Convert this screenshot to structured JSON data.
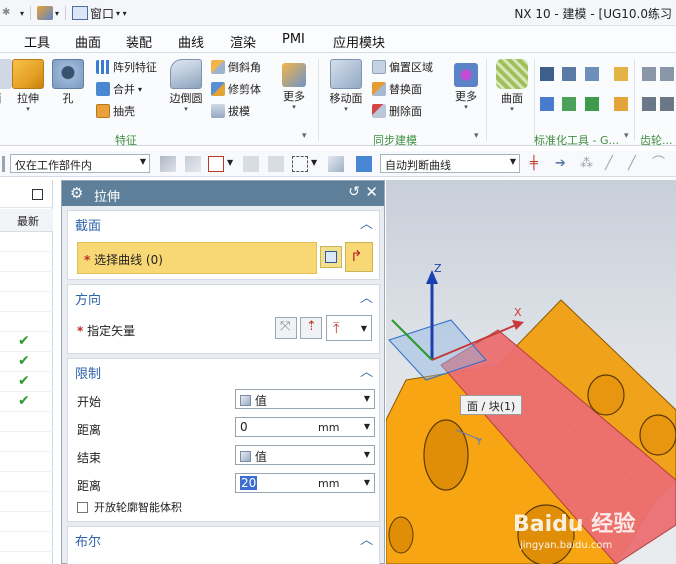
{
  "window": {
    "title": "NX 10 - 建模 - [UG10.0练习"
  },
  "quick_access": {
    "window_menu": "窗口"
  },
  "menubar": {
    "items": [
      "工具",
      "曲面",
      "装配",
      "曲线",
      "渲染",
      "PMI",
      "应用模块"
    ]
  },
  "ribbon": {
    "extrude": "拉伸",
    "hole": "孔",
    "pattern_feature": "阵列特征",
    "unite": "合并",
    "shell": "抽壳",
    "edge_blend": "边倒圆",
    "chamfer": "倒斜角",
    "trim_body": "修剪体",
    "draft": "拔模",
    "more1": "更多",
    "move_face": "移动面",
    "offset_region": "偏置区域",
    "replace_face": "替换面",
    "delete_face": "删除面",
    "more2": "更多",
    "surface": "曲面",
    "group_feature": "特征",
    "group_sync": "同步建模",
    "group_std": "标准化工具 - G...",
    "group_gear": "齿轮..."
  },
  "selection_bar": {
    "scope": "仅在工作部件内",
    "curve_rule": "自动判断曲线"
  },
  "navigator": {
    "column_latest": "最新"
  },
  "dialog": {
    "title": "拉伸",
    "section": {
      "title": "截面",
      "select_curve": "选择曲线 (0)"
    },
    "direction": {
      "title": "方向",
      "specify_vector": "指定矢量"
    },
    "limits": {
      "title": "限制",
      "start_label": "开始",
      "start_value": "值",
      "distance_label": "距离",
      "start_distance": "0",
      "unit": "mm",
      "end_label": "结束",
      "end_value": "值",
      "end_distance": "20",
      "open_profile": "开放轮廓智能体积"
    },
    "boolean": {
      "title": "布尔"
    }
  },
  "viewport": {
    "tooltip": "面 / 块(1)",
    "axis_z": "Z",
    "axis_x": "X",
    "axis_y": "Y",
    "watermark": "Baidu 经验",
    "watermark_url": "jingyan.baidu.com"
  },
  "colors": {
    "dialog_title": "#5d7f99",
    "section_title": "#2f62a8",
    "selected_row": "#f8d775",
    "part_body": "#f7a512",
    "highlight_face": "#ec6f72"
  }
}
